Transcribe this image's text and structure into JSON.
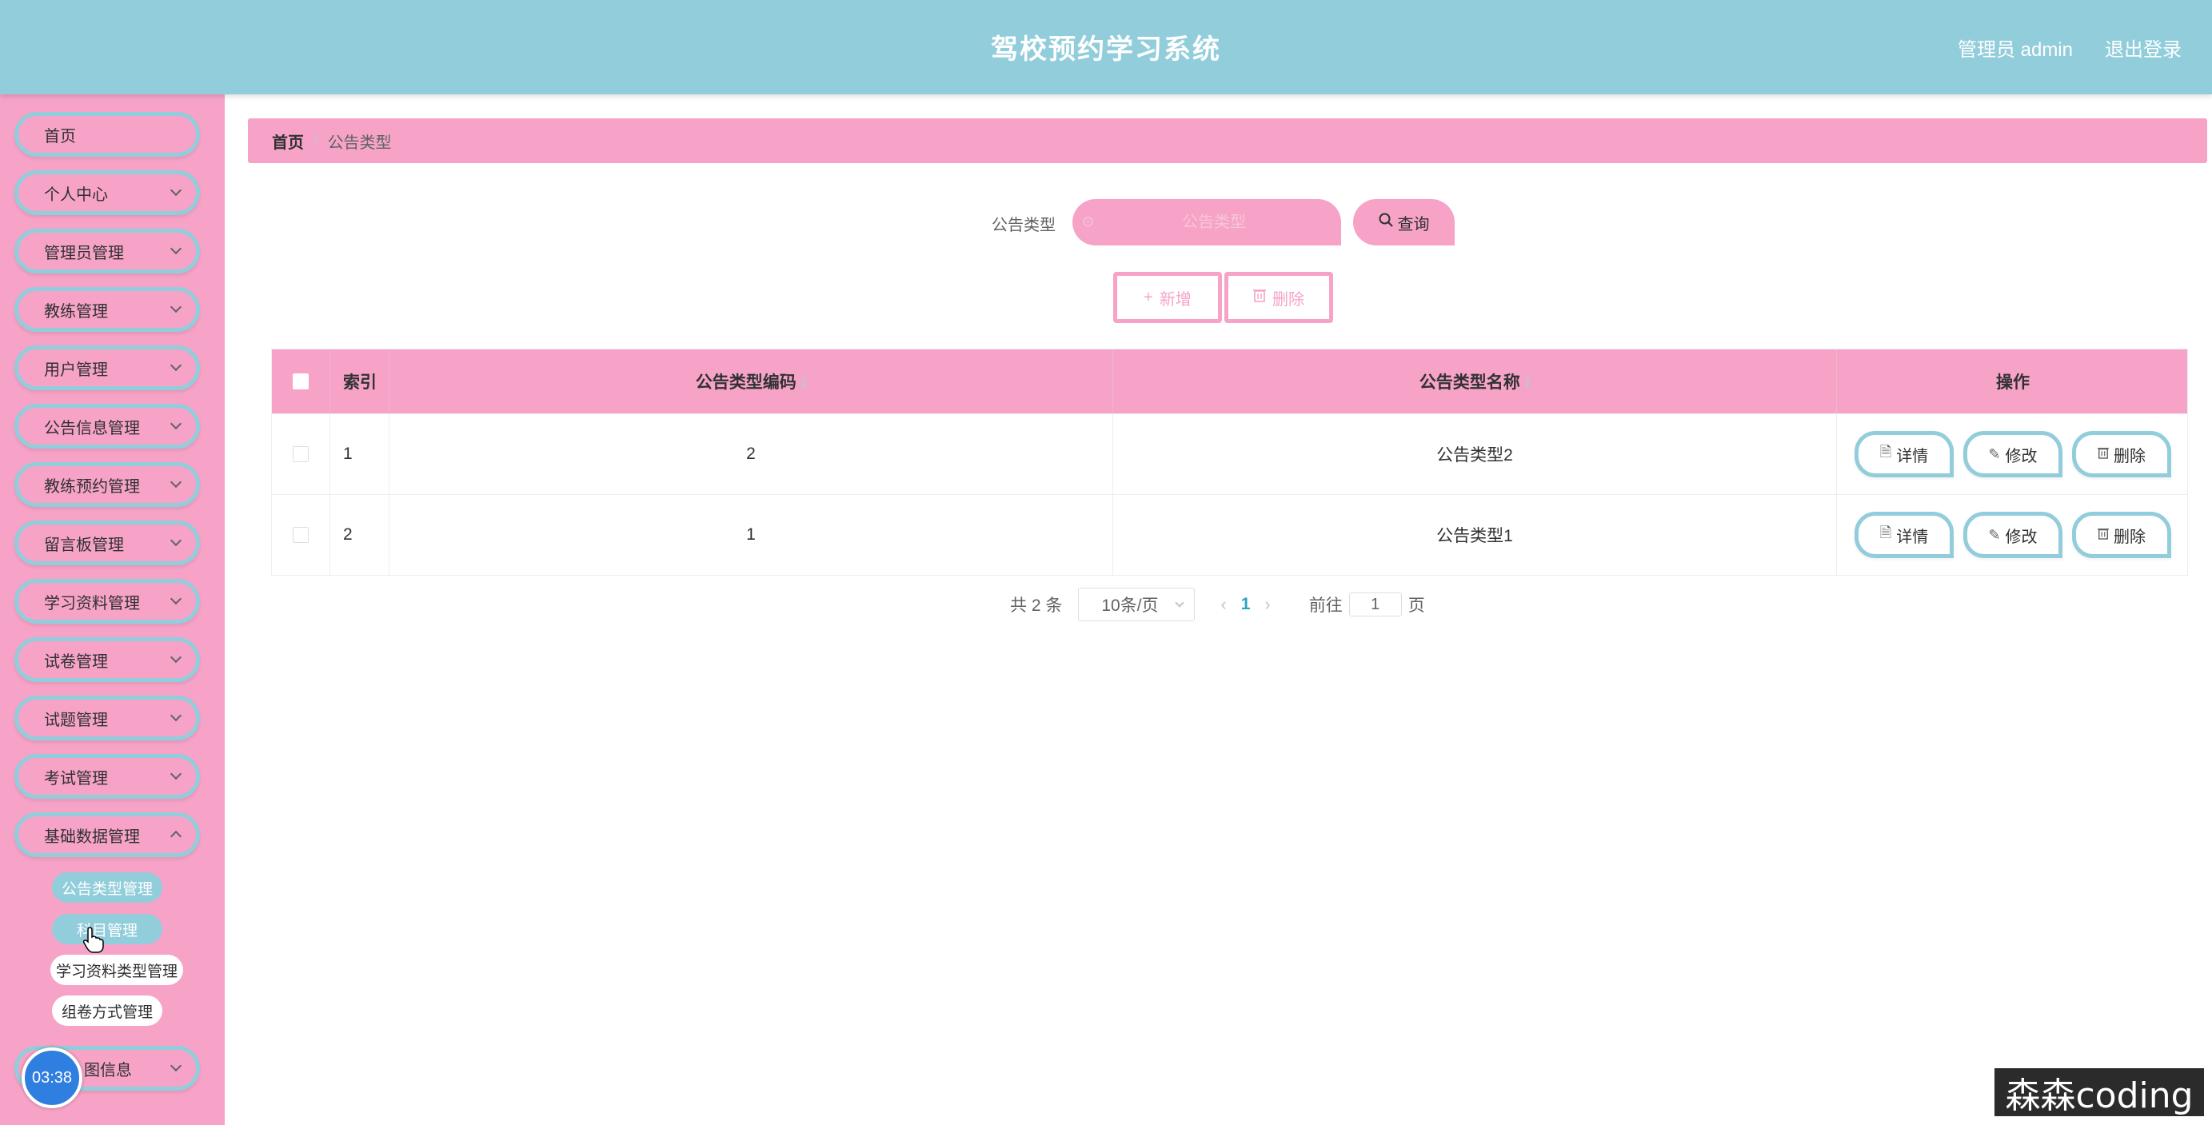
{
  "header": {
    "title": "驾校预约学习系统",
    "user": "管理员 admin",
    "logout": "退出登录"
  },
  "sidebar": {
    "items": [
      {
        "label": "首页",
        "has_children": false
      },
      {
        "label": "个人中心",
        "has_children": true
      },
      {
        "label": "管理员管理",
        "has_children": true
      },
      {
        "label": "教练管理",
        "has_children": true
      },
      {
        "label": "用户管理",
        "has_children": true
      },
      {
        "label": "公告信息管理",
        "has_children": true
      },
      {
        "label": "教练预约管理",
        "has_children": true
      },
      {
        "label": "留言板管理",
        "has_children": true
      },
      {
        "label": "学习资料管理",
        "has_children": true
      },
      {
        "label": "试卷管理",
        "has_children": true
      },
      {
        "label": "试题管理",
        "has_children": true
      },
      {
        "label": "考试管理",
        "has_children": true
      },
      {
        "label": "基础数据管理",
        "has_children": true
      },
      {
        "label": "图信息",
        "has_children": true
      }
    ],
    "subitems": [
      {
        "label": "公告类型管理"
      },
      {
        "label": "科目管理"
      },
      {
        "label": "学习资料类型管理"
      },
      {
        "label": "组卷方式管理"
      }
    ],
    "timer": "03:38"
  },
  "breadcrumb": {
    "home": "首页",
    "separator": "/",
    "current": "公告类型"
  },
  "search": {
    "label": "公告类型",
    "placeholder": "公告类型",
    "query_button": "查询"
  },
  "actions": {
    "add": "新增",
    "delete": "删除"
  },
  "table": {
    "columns": [
      "索引",
      "公告类型编码",
      "公告类型名称",
      "操作"
    ],
    "rows": [
      {
        "index": "1",
        "code": "2",
        "name": "公告类型2"
      },
      {
        "index": "2",
        "code": "1",
        "name": "公告类型1"
      }
    ],
    "row_actions": {
      "detail": "详情",
      "edit": "修改",
      "delete": "删除"
    }
  },
  "pagination": {
    "total": "共 2 条",
    "page_size": "10条/页",
    "current_page": "1",
    "goto_label": "前往",
    "goto_value": "1",
    "page_suffix": "页"
  },
  "watermark": "森森coding",
  "colors": {
    "header": "#92cddb",
    "sidebar": "#f6a3c7",
    "accent_pink": "#f6a3c7",
    "accent_teal": "#92cddb",
    "page_active": "#2aa2c7"
  }
}
